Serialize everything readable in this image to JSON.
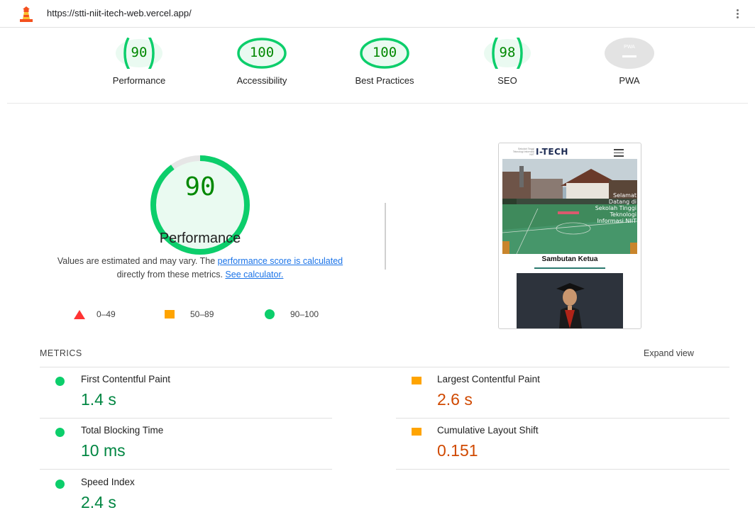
{
  "header": {
    "url": "https://stti-niit-itech-web.vercel.app/",
    "logo_icon": "lighthouse-icon",
    "menu_icon": "kebab-menu-icon"
  },
  "summary": [
    {
      "score": "90",
      "label": "Performance",
      "status": "pass"
    },
    {
      "score": "100",
      "label": "Accessibility",
      "status": "pass"
    },
    {
      "score": "100",
      "label": "Best Practices",
      "status": "pass"
    },
    {
      "score": "98",
      "label": "SEO",
      "status": "pass"
    },
    {
      "score": "PWA",
      "label": "PWA",
      "status": "na"
    }
  ],
  "performance": {
    "score": "90",
    "score_fraction": 0.9,
    "title": "Performance",
    "desc_start": "Values are estimated and may vary. The ",
    "desc_link1": "performance score is calculated",
    "desc_middle": " directly from these metrics. ",
    "desc_link2": "See calculator."
  },
  "legend": [
    {
      "shape": "triangle",
      "range": "0–49",
      "color": "#ff3333"
    },
    {
      "shape": "square",
      "range": "50–89",
      "color": "#ffa400"
    },
    {
      "shape": "circle",
      "range": "90–100",
      "color": "#0cce6b"
    }
  ],
  "thumbnail": {
    "small_text": "Sekolah Tinggi Teknologi Informasi NIIT",
    "logo": "I-TECH",
    "hero_text": "Selamat Datang di Sekolah Tinggi Teknologi Informasi NIIT",
    "heading": "Sambutan Ketua"
  },
  "metrics": {
    "title": "METRICS",
    "expand_label": "Expand view",
    "items": [
      {
        "name": "First Contentful Paint",
        "value": "1.4 s",
        "status": "pass"
      },
      {
        "name": "Largest Contentful Paint",
        "value": "2.6 s",
        "status": "average"
      },
      {
        "name": "Total Blocking Time",
        "value": "10 ms",
        "status": "pass"
      },
      {
        "name": "Cumulative Layout Shift",
        "value": "0.151",
        "status": "average"
      },
      {
        "name": "Speed Index",
        "value": "2.4 s",
        "status": "pass"
      }
    ]
  },
  "colors": {
    "pass": "#0cce6b",
    "pass_text": "#008800",
    "average": "#ffa400",
    "average_text": "#c33300",
    "fail": "#ff3333",
    "link": "#1a73e8"
  }
}
